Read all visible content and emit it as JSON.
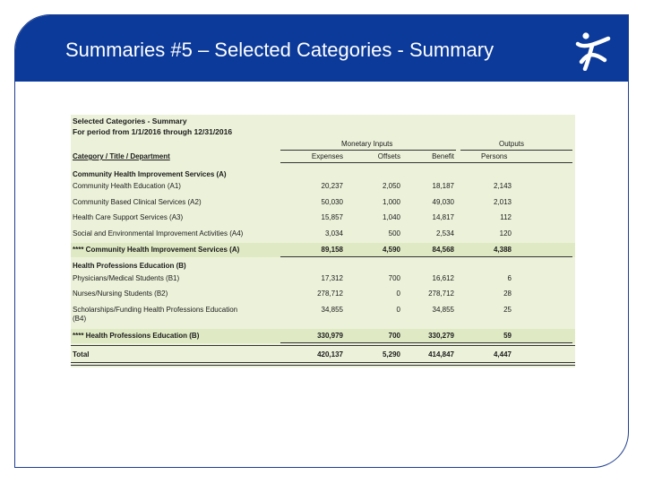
{
  "slide": {
    "title": "Summaries #5 – Selected Categories - Summary",
    "colors": {
      "header": "#0b3a9a",
      "table_bg": "#ecf2da"
    },
    "logo_icon": "cbisa-figure-logo"
  },
  "report": {
    "heading": "Selected Categories - Summary",
    "period": "For period from 1/1/2016 through 12/31/2016",
    "group_monetary": "Monetary Inputs",
    "group_outputs": "Outputs",
    "col_category": "Category / Title / Department",
    "col_expenses": "Expenses",
    "col_offsets": "Offsets",
    "col_benefit": "Benefit",
    "col_persons": "Persons",
    "rows": [
      {
        "label": "Community Health Improvement Services (A)",
        "type": "section"
      },
      {
        "label": "Community Health Education (A1)",
        "expenses": "20,237",
        "offsets": "2,050",
        "benefit": "18,187",
        "persons": "2,143"
      },
      {
        "label": "Community Based Clinical Services (A2)",
        "expenses": "50,030",
        "offsets": "1,000",
        "benefit": "49,030",
        "persons": "2,013"
      },
      {
        "label": "Health Care Support Services (A3)",
        "expenses": "15,857",
        "offsets": "1,040",
        "benefit": "14,817",
        "persons": "112"
      },
      {
        "label": "Social and Environmental Improvement Activities (A4)",
        "expenses": "3,034",
        "offsets": "500",
        "benefit": "2,534",
        "persons": "120"
      },
      {
        "label": "**** Community Health Improvement Services (A)",
        "expenses": "89,158",
        "offsets": "4,590",
        "benefit": "84,568",
        "persons": "4,388",
        "type": "subtotal"
      },
      {
        "label": "Health Professions Education (B)",
        "type": "section"
      },
      {
        "label": "Physicians/Medical Students (B1)",
        "expenses": "17,312",
        "offsets": "700",
        "benefit": "16,612",
        "persons": "6"
      },
      {
        "label": "Nurses/Nursing Students (B2)",
        "expenses": "278,712",
        "offsets": "0",
        "benefit": "278,712",
        "persons": "28"
      },
      {
        "label": "Scholarships/Funding Health Professions Education",
        "label2": "(B4)",
        "expenses": "34,855",
        "offsets": "0",
        "benefit": "34,855",
        "persons": "25"
      },
      {
        "label": "**** Health Professions Education (B)",
        "expenses": "330,979",
        "offsets": "700",
        "benefit": "330,279",
        "persons": "59",
        "type": "subtotal"
      },
      {
        "label": "Total",
        "expenses": "420,137",
        "offsets": "5,290",
        "benefit": "414,847",
        "persons": "4,447",
        "type": "total"
      }
    ]
  }
}
